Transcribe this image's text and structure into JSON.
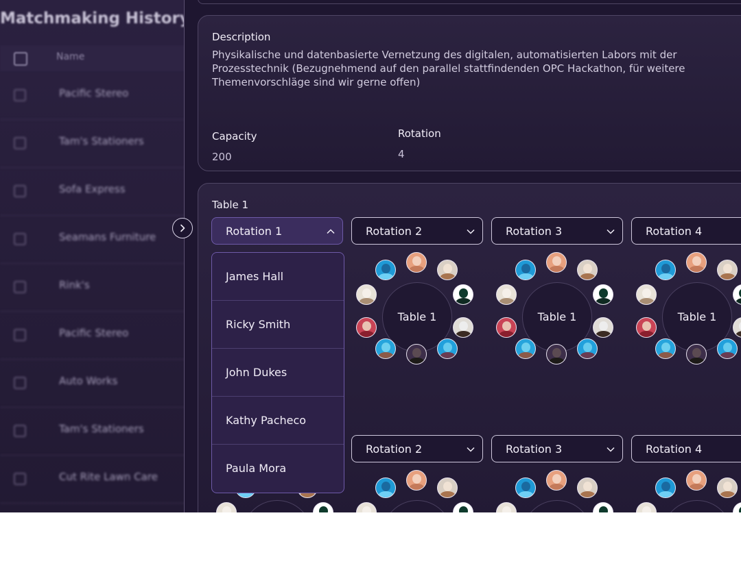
{
  "left": {
    "title": "Matchmaking History",
    "column_name": "Name",
    "rows": [
      "Pacific Stereo",
      "Tam's Stationers",
      "Sofa Express",
      "Seamans Furniture",
      "Rink's",
      "Pacific Stereo",
      "Auto Works",
      "Tam's Stationers",
      "Cut Rite Lawn Care"
    ]
  },
  "details": {
    "description_label": "Description",
    "description": "Physikalische und datenbasierte Vernetzung des digitalen, automatisierten Labors mit der Prozesstechnik (Bezugnehmend auf den parallel stattfindenden OPC Hackathon, für weitere Themenvorschläge sind wir gerne offen)",
    "capacity_label": "Capacity",
    "capacity": "200",
    "rotation_label": "Rotation",
    "rotation": "4"
  },
  "tables": {
    "title": "Table 1",
    "rotations": [
      "Rotation 1",
      "Rotation 2",
      "Rotation 3",
      "Rotation 4"
    ],
    "second_row_rotations": [
      "Rotation 2",
      "Rotation 3",
      "Rotation 4"
    ],
    "table_label": "Table 1",
    "dropdown_options": [
      "James Hall",
      "Ricky Smith",
      "John Dukes",
      "Kathy Pacheco",
      "Paula Mora"
    ]
  },
  "colors": {
    "accent": "#6e5aa8",
    "panel_bg": "#1e1630",
    "border": "#4f4564"
  }
}
